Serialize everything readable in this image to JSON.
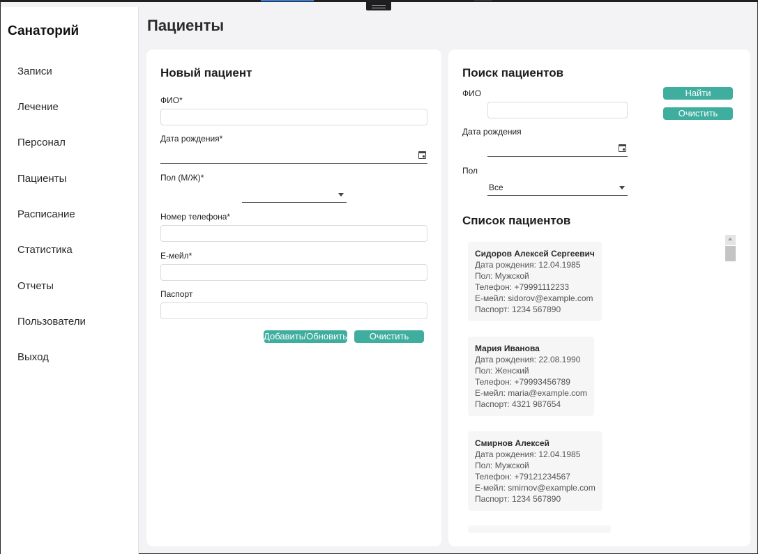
{
  "sidebar": {
    "app_title": "Санаторий",
    "items": [
      {
        "label": "Записи"
      },
      {
        "label": "Лечение"
      },
      {
        "label": "Персонал"
      },
      {
        "label": "Пациенты"
      },
      {
        "label": "Расписание"
      },
      {
        "label": "Статистика"
      },
      {
        "label": "Отчеты"
      },
      {
        "label": "Пользователи"
      },
      {
        "label": "Выход"
      }
    ]
  },
  "page": {
    "title": "Пациенты"
  },
  "new_patient": {
    "title": "Новый пациент",
    "fio_label": "ФИО*",
    "fio_value": "",
    "birth_label": "Дата рождения*",
    "birth_value": "",
    "sex_label": "Пол (М/Ж)*",
    "sex_value": "",
    "phone_label": "Номер телефона*",
    "phone_value": "",
    "email_label": "E-мейл*",
    "email_value": "",
    "passport_label": "Паспорт",
    "passport_value": "",
    "save_button": "Добавить/Обновить",
    "clear_button": "Очистить"
  },
  "search": {
    "title": "Поиск пациентов",
    "fio_label": "ФИО",
    "fio_value": "",
    "birth_label": "Дата рождения",
    "birth_value": "",
    "sex_label": "Пол",
    "sex_value": "Все",
    "find_button": "Найти",
    "clear_button": "Очистить"
  },
  "patient_list": {
    "title": "Список пациентов",
    "patients": [
      {
        "name": "Сидоров Алексей Сергеевич",
        "birth": "Дата рождения: 12.04.1985",
        "sex": "Пол: Мужской",
        "phone": "Телефон: +79991112233",
        "email": "E-мейл: sidorov@example.com",
        "passport": "Паспорт: 1234 567890"
      },
      {
        "name": "Мария Иванова",
        "birth": "Дата рождения: 22.08.1990",
        "sex": "Пол: Женский",
        "phone": "Телефон: +79993456789",
        "email": "E-мейл: maria@example.com",
        "passport": "Паспорт: 4321 987654"
      },
      {
        "name": "Смирнов Алексей",
        "birth": "Дата рождения: 12.04.1985",
        "sex": "Пол: Мужской",
        "phone": "Телефон: +79121234567",
        "email": "E-мейл: smirnov@example.com",
        "passport": "Паспорт: 1234 567890"
      }
    ]
  },
  "icons": {
    "calendar": "calendar-icon",
    "dropdown": "chevron-down-icon",
    "scroll_up": "arrow-up-icon"
  },
  "colors": {
    "accent": "#3fae9f",
    "background": "#f3f3f6",
    "card": "#ffffff",
    "patient_card": "#f6f6f6"
  }
}
